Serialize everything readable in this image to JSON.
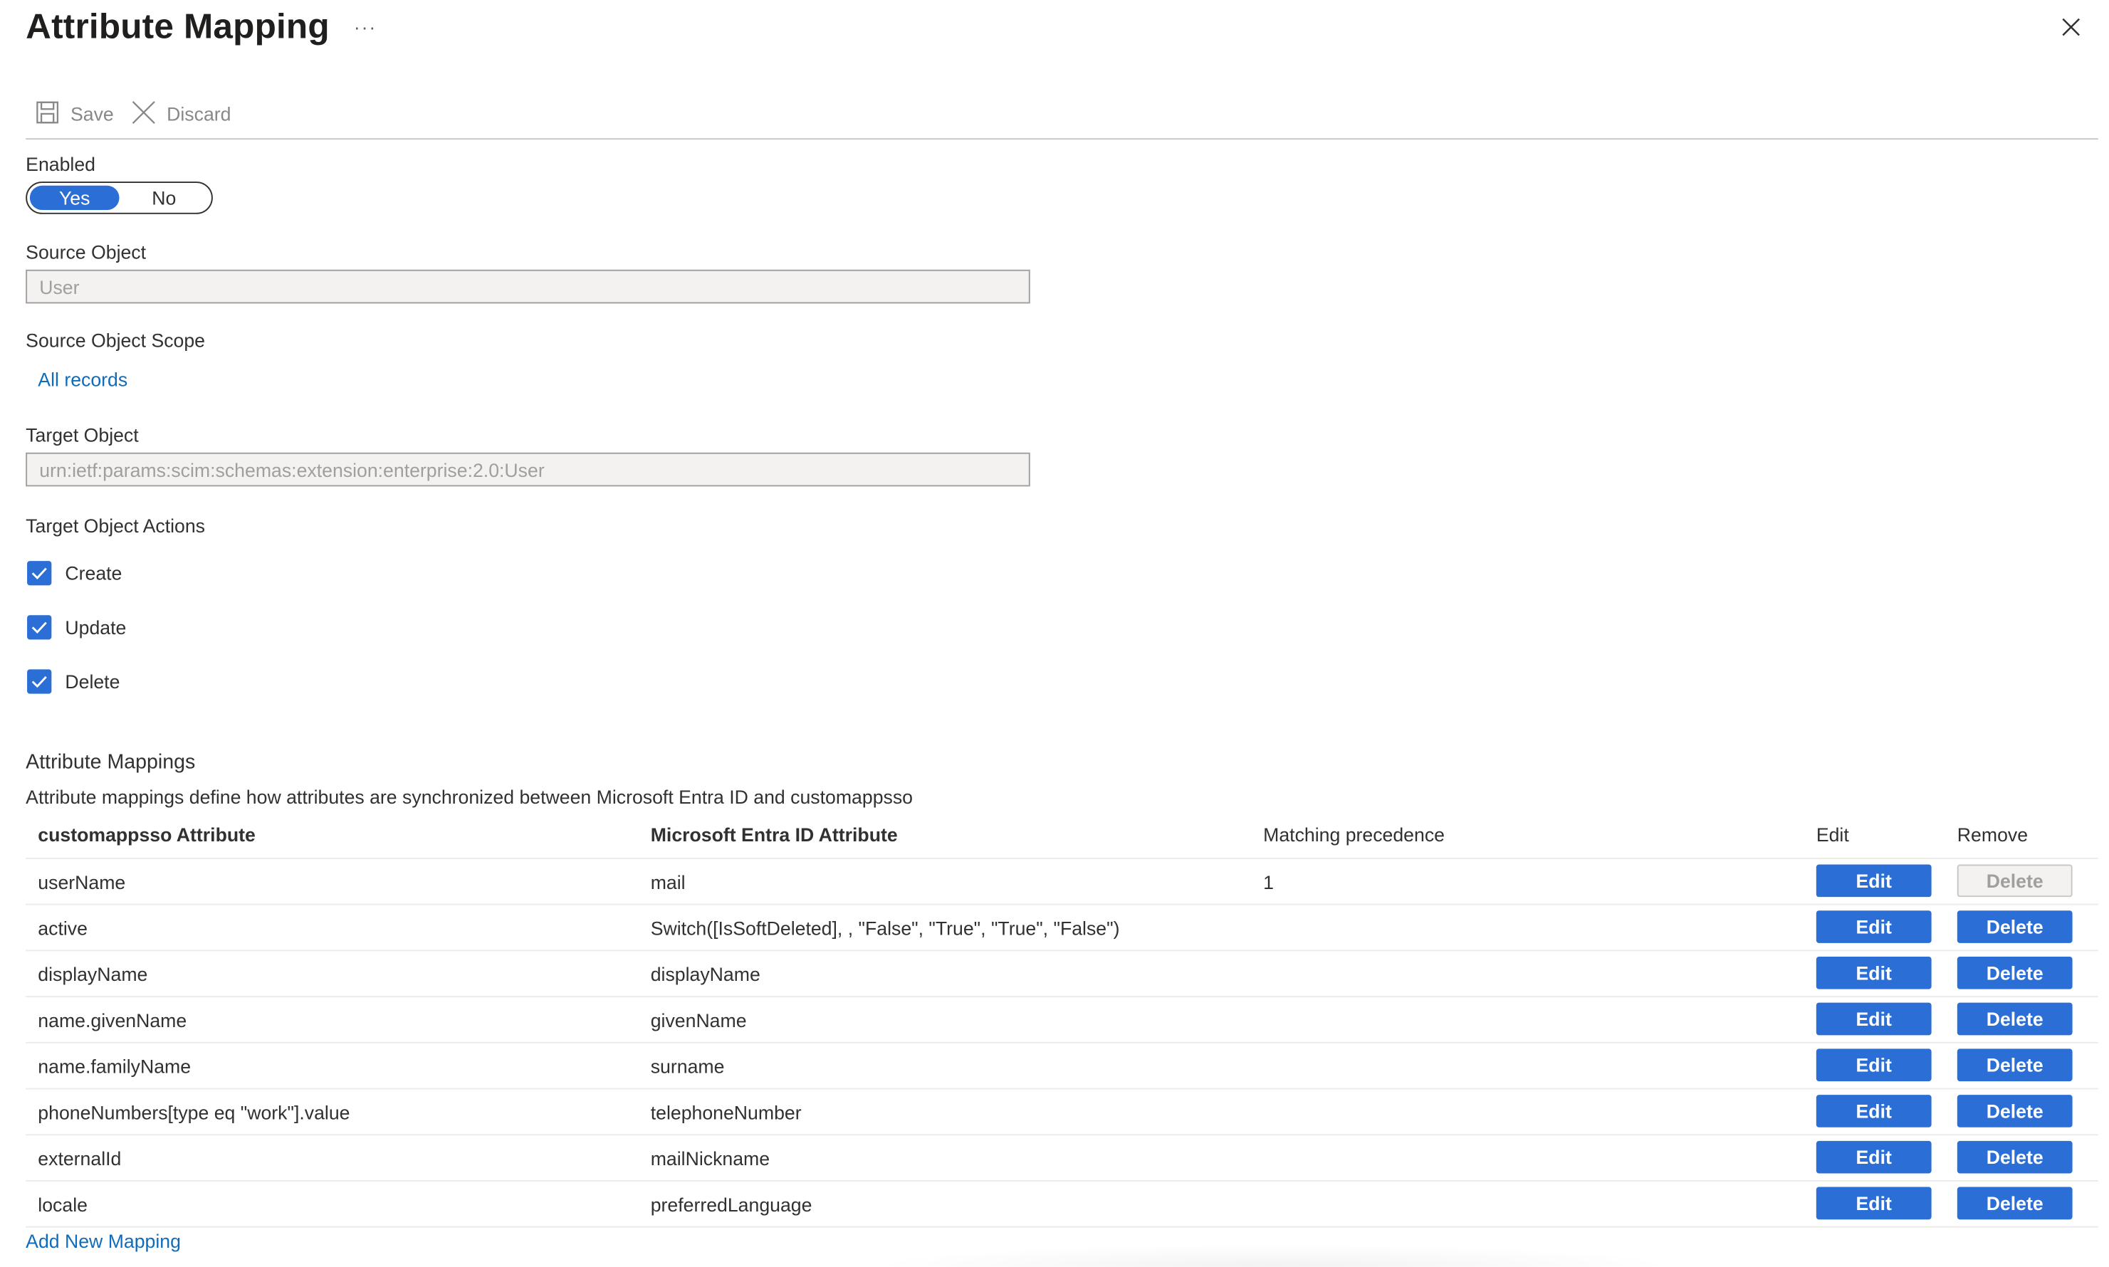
{
  "panel": {
    "title": "Attribute Mapping",
    "more_label": "···"
  },
  "toolbar": {
    "save_label": "Save",
    "discard_label": "Discard"
  },
  "enabled": {
    "label": "Enabled",
    "yes_label": "Yes",
    "no_label": "No",
    "selected": "Yes"
  },
  "source_object": {
    "label": "Source Object",
    "value": "User"
  },
  "source_scope": {
    "label": "Source Object Scope",
    "link": "All records"
  },
  "target_object": {
    "label": "Target Object",
    "value": "urn:ietf:params:scim:schemas:extension:enterprise:2.0:User"
  },
  "target_actions": {
    "label": "Target Object Actions",
    "items": [
      {
        "label": "Create",
        "checked": true
      },
      {
        "label": "Update",
        "checked": true
      },
      {
        "label": "Delete",
        "checked": true
      }
    ]
  },
  "mappings": {
    "title": "Attribute Mappings",
    "description": "Attribute mappings define how attributes are synchronized between Microsoft Entra ID and customappsso",
    "headers": {
      "app_attr": "customappsso Attribute",
      "entra_attr": "Microsoft Entra ID Attribute",
      "precedence": "Matching precedence",
      "edit": "Edit",
      "remove": "Remove"
    },
    "rows": [
      {
        "app_attr": "userName",
        "entra_attr": "mail",
        "precedence": "1",
        "edit": "Edit",
        "delete": "Delete",
        "delete_disabled": true
      },
      {
        "app_attr": "active",
        "entra_attr": "Switch([IsSoftDeleted], , \"False\", \"True\", \"True\", \"False\")",
        "precedence": "",
        "edit": "Edit",
        "delete": "Delete",
        "delete_disabled": false
      },
      {
        "app_attr": "displayName",
        "entra_attr": "displayName",
        "precedence": "",
        "edit": "Edit",
        "delete": "Delete",
        "delete_disabled": false
      },
      {
        "app_attr": "name.givenName",
        "entra_attr": "givenName",
        "precedence": "",
        "edit": "Edit",
        "delete": "Delete",
        "delete_disabled": false
      },
      {
        "app_attr": "name.familyName",
        "entra_attr": "surname",
        "precedence": "",
        "edit": "Edit",
        "delete": "Delete",
        "delete_disabled": false
      },
      {
        "app_attr": "phoneNumbers[type eq \"work\"].value",
        "entra_attr": "telephoneNumber",
        "precedence": "",
        "edit": "Edit",
        "delete": "Delete",
        "delete_disabled": false
      },
      {
        "app_attr": "externalId",
        "entra_attr": "mailNickname",
        "precedence": "",
        "edit": "Edit",
        "delete": "Delete",
        "delete_disabled": false
      },
      {
        "app_attr": "locale",
        "entra_attr": "preferredLanguage",
        "precedence": "",
        "edit": "Edit",
        "delete": "Delete",
        "delete_disabled": false
      }
    ],
    "add_link": "Add New Mapping"
  },
  "colors": {
    "accent": "#2b6fd6",
    "link": "#0f6cbd",
    "text": "#323130"
  },
  "icons": [
    "more-icon",
    "close-icon",
    "save-icon",
    "discard-icon",
    "checkmark-icon"
  ]
}
